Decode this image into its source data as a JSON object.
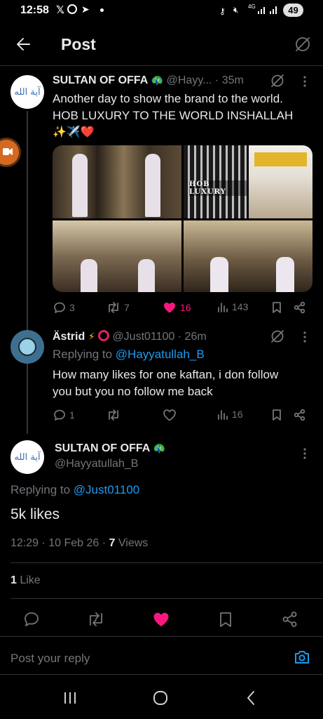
{
  "status_bar": {
    "time": "12:58",
    "battery": "49",
    "net": "4G"
  },
  "header": {
    "title": "Post"
  },
  "tweet1": {
    "name": "SULTAN OF OFFA",
    "handle": "@Hayy...",
    "time": "· 35m",
    "text_line1": "Another day to show the brand to the world.",
    "text_line2": "HOB LUXURY TO THE WORLD INSHALLAH",
    "text_line3": "✨✈️❤️",
    "avatar_text": "آية الله",
    "store_sign": "HOB LUXURY",
    "replies": "3",
    "reposts": "7",
    "likes": "16",
    "views": "143"
  },
  "tweet2": {
    "name": "Ästrid",
    "handle": "@Just01100",
    "time": "· 26m",
    "replying_prefix": "Replying to ",
    "replying_to": "@Hayyatullah_B",
    "text_line1": "How many likes for one kaftan, i don follow",
    "text_line2": "you but you no follow me back",
    "replies": "1",
    "reposts": "",
    "likes": "",
    "views": "16"
  },
  "main_tweet": {
    "name": "SULTAN OF OFFA",
    "handle": "@Hayyatullah_B",
    "avatar_text": "آية الله",
    "replying_prefix": "Replying to ",
    "replying_to": "@Just01100",
    "text": "5k likes",
    "timestamp": "12:29 · 10 Feb 26 · ",
    "views_count": "7",
    "views_label": " Views",
    "likes_count": "1",
    "likes_label": " Like"
  },
  "reply_box": {
    "placeholder": "Post your reply"
  },
  "colors": {
    "accent": "#1d9bf0",
    "like": "#f91880",
    "bg": "#000000"
  }
}
